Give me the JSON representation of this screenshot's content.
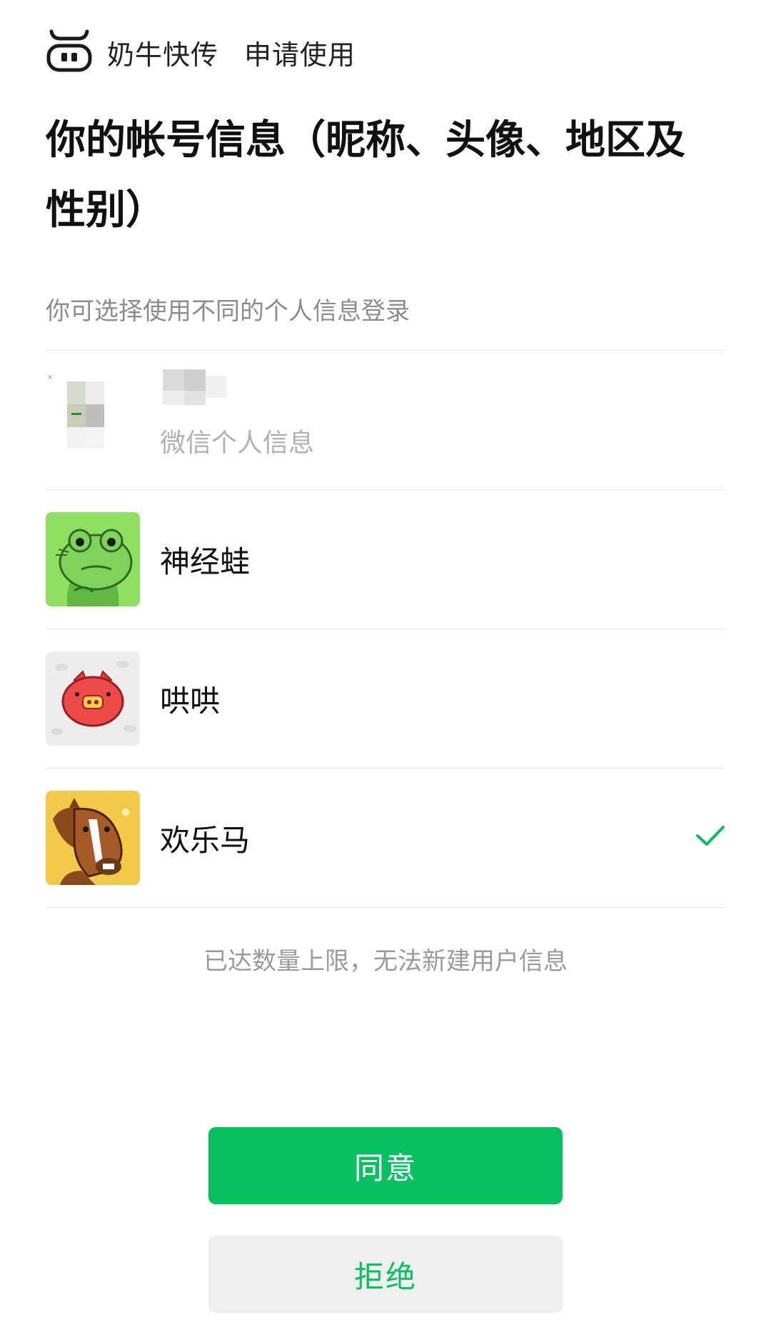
{
  "header": {
    "app_name": "奶牛快传",
    "request_text": "申请使用",
    "logo_icon": "cow-logo-icon"
  },
  "title": "你的帐号信息（昵称、头像、地区及性别）",
  "subtitle": "你可选择使用不同的个人信息登录",
  "profiles": [
    {
      "label": "微信个人信息",
      "avatar_icon": "blurred-avatar-icon",
      "selected": false
    },
    {
      "label": "神经蛙",
      "avatar_icon": "frog-avatar-icon",
      "selected": false
    },
    {
      "label": "哄哄",
      "avatar_icon": "pig-avatar-icon",
      "selected": false
    },
    {
      "label": "欢乐马",
      "avatar_icon": "horse-avatar-icon",
      "selected": true
    }
  ],
  "limit_text": "已达数量上限，无法新建用户信息",
  "buttons": {
    "agree": "同意",
    "reject": "拒绝"
  },
  "colors": {
    "primary": "#07c160",
    "secondary_bg": "#efefef",
    "muted_text": "#9a9a9a"
  }
}
